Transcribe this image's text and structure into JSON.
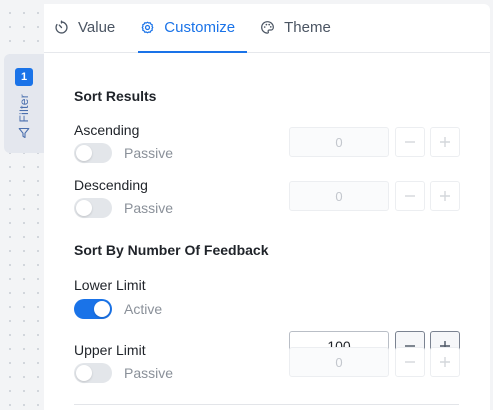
{
  "side_tab": {
    "badge": "1",
    "label": "Filter"
  },
  "tabs": [
    {
      "label": "Value",
      "icon": "timer-icon",
      "active": false
    },
    {
      "label": "Customize",
      "icon": "gear-icon",
      "active": true
    },
    {
      "label": "Theme",
      "icon": "palette-icon",
      "active": false
    }
  ],
  "sort_results": {
    "title": "Sort Results",
    "ascending": {
      "label": "Ascending",
      "toggle_text": "Passive",
      "enabled": false,
      "value": "0"
    },
    "descending": {
      "label": "Descending",
      "toggle_text": "Passive",
      "enabled": false,
      "value": "0"
    }
  },
  "sort_by_feedback": {
    "title": "Sort By Number Of Feedback",
    "lower_limit": {
      "label": "Lower Limit",
      "toggle_text": "Active",
      "enabled": true,
      "value": "100"
    },
    "upper_limit": {
      "label": "Upper Limit",
      "toggle_text": "Passive",
      "enabled": false,
      "value": "0"
    }
  },
  "colors": {
    "accent": "#1a73e8",
    "muted_text": "#8a9099"
  }
}
